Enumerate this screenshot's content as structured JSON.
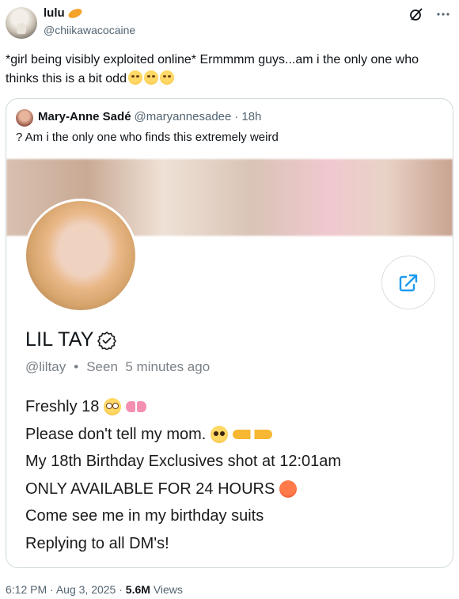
{
  "author": {
    "name": "lulu",
    "handle": "@chiikawacocaine",
    "badge_icon": "pill-emoji-icon"
  },
  "tweet": {
    "text": "*girl being visibly exploited online* Ermmmm guys...am i the only one who thinks this is a bit odd",
    "trailing_emojis": [
      "grinning-sweat-emoji-icon",
      "grinning-sweat-emoji-icon",
      "flushed-emoji-icon"
    ]
  },
  "quoted": {
    "name": "Mary-Anne Sadé",
    "handle": "@maryannesadee",
    "separator": "·",
    "time": "18h",
    "text": "? Am i the only one who finds this extremely weird",
    "profile": {
      "display_name": "LIL TAY",
      "handle": "@liltay",
      "dot": "•",
      "seen": "Seen  5 minutes ago",
      "bio_lines": [
        "Freshly 18",
        "Please don't tell my mom.",
        "My 18th Birthday Exclusives shot at 12:01am",
        "ONLY AVAILABLE FOR 24 HOURS",
        "Come see me in my birthday suits",
        "Replying to all DM's!"
      ]
    }
  },
  "footer": {
    "time": "6:12 PM",
    "sep1": "·",
    "date": "Aug 3, 2025",
    "sep2": "·",
    "views_count": "5.6M",
    "views_label": "Views"
  },
  "colors": {
    "text": "#0f1419",
    "muted": "#536471",
    "border": "#cfd9de",
    "link_blue": "#1d9bf0"
  }
}
